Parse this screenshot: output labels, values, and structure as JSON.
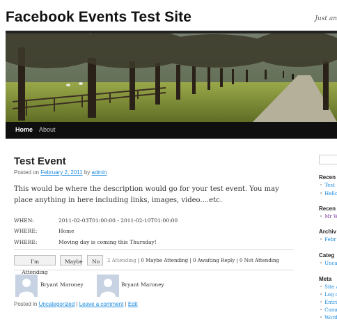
{
  "site": {
    "title": "Facebook Events Test Site",
    "tagline": "Just an"
  },
  "nav": {
    "items": [
      {
        "label": "Home"
      },
      {
        "label": "About"
      }
    ]
  },
  "post": {
    "title": "Test Event",
    "posted_on_prefix": "Posted on",
    "date": "February 2, 2011",
    "by": "by",
    "author": "admin",
    "description": "This would be where the description would go for your test event.  You may place anything in here including links, images, video....etc.",
    "details": [
      {
        "label": "WHEN:",
        "value": "2011-02-03T01:00:00 - 2011-02-10T01:00:00"
      },
      {
        "label": "WHERE:",
        "value": "Home"
      },
      {
        "label": "WHERE:",
        "value": "Moving day is coming this Thursday!"
      }
    ],
    "rsvp": {
      "attending_button": "I'm Attending",
      "maybe_button": "Maybe",
      "no_button": "No",
      "attending_count": "2 Attending",
      "counts_rest": " | 0 Maybe Attending | 0 Awaiting Reply | 0 Not Attending"
    },
    "attendees": [
      {
        "name": "Bryant Maroney"
      },
      {
        "name": "Bryant Maroney"
      }
    ],
    "footer": {
      "posted_in": "Posted in",
      "category": "Uncategorized",
      "sep1": "|",
      "comment": "Leave a comment",
      "sep2": "|",
      "edit": "Edit"
    }
  },
  "sidebar": {
    "sections": [
      {
        "heading": "Recen",
        "items": [
          "Test",
          "Hello"
        ]
      },
      {
        "heading": "Recen",
        "items": [
          "Mr W"
        ]
      },
      {
        "heading": "Archiv",
        "items": [
          "Febr"
        ]
      },
      {
        "heading": "Categ",
        "items": [
          "Unca"
        ]
      },
      {
        "heading": "Meta",
        "items": [
          "Site A",
          "Log o",
          "Entri",
          "Comm",
          "Word"
        ]
      }
    ]
  },
  "colors": {
    "link": "#1b8be0",
    "nav_bg": "#0f0f0f",
    "avatar_bg": "#c7d3e3"
  }
}
